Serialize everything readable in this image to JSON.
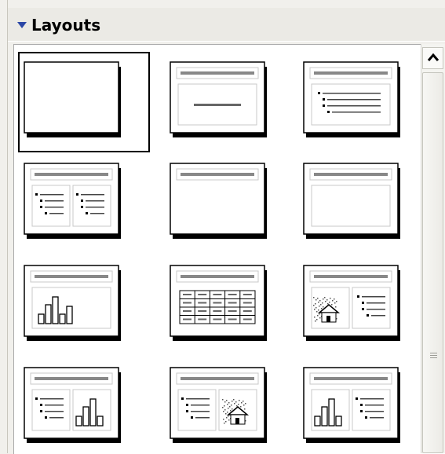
{
  "header": {
    "title": "Layouts"
  },
  "layouts": [
    {
      "kind": "blank"
    },
    {
      "kind": "title-content"
    },
    {
      "kind": "title-outline"
    },
    {
      "kind": "title-2outline"
    },
    {
      "kind": "title-only"
    },
    {
      "kind": "title-box"
    },
    {
      "kind": "title-chart"
    },
    {
      "kind": "title-table"
    },
    {
      "kind": "title-clipart-outline"
    },
    {
      "kind": "title-outline-chart"
    },
    {
      "kind": "title-outline-clipart"
    },
    {
      "kind": "title-chart-outline"
    }
  ],
  "icons": {
    "collapse": "triangle-down-icon",
    "scroll_up": "chevron-up-icon",
    "grip": "grip-icon"
  },
  "colors": {
    "accent": "#2b47a6"
  }
}
